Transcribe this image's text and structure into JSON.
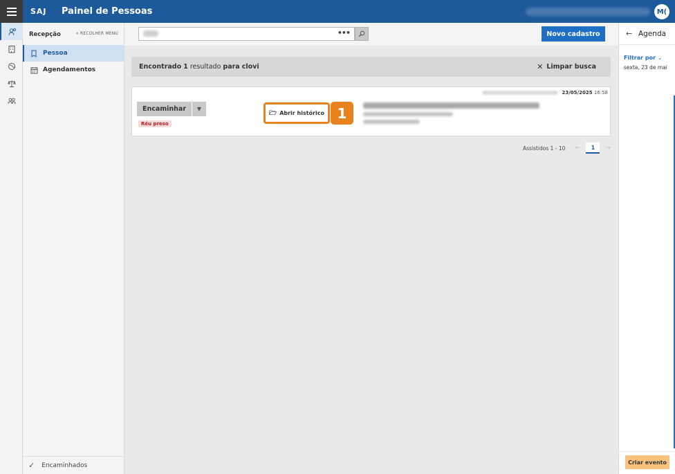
{
  "topbar": {
    "brand": "SAJ",
    "title": "Painel de Pessoas",
    "avatar": "M("
  },
  "rail": {
    "icons": [
      "people-search-icon",
      "building-icon",
      "globe-icon",
      "scale-icon",
      "group-icon"
    ]
  },
  "sidebar": {
    "title": "Recepção",
    "collapse_label": "« RECOLHER MENU",
    "items": [
      {
        "label": "Pessoa",
        "icon": "bookmark-icon",
        "active": true
      },
      {
        "label": "Agendamentos",
        "icon": "calendar-icon",
        "active": false
      }
    ],
    "footer_label": "Encaminhados"
  },
  "search": {
    "new_button": "Novo cadastro"
  },
  "results": {
    "prefix": "Encontrado",
    "count": "1",
    "middle": "resultado",
    "for_word": "para",
    "query": "clovi",
    "clear_label": "Limpar busca"
  },
  "card": {
    "date": "23/05/2025",
    "time": "16:58",
    "forward_label": "Encaminhar",
    "badge": "Réu preso",
    "history_label": "Abrir histórico",
    "step_number": "1"
  },
  "pager": {
    "label": "Assistidos 1 - 10",
    "current_page": "1"
  },
  "agenda": {
    "title": "Agenda",
    "filter_label": "Filtrar por",
    "date_label": "sexta, 23 de mai",
    "create_event": "Criar evento"
  },
  "colors": {
    "primary": "#1d5a9c",
    "button_blue": "#1f6fc5",
    "accent_orange": "#e8821e",
    "badge_red": "#b01e24"
  }
}
